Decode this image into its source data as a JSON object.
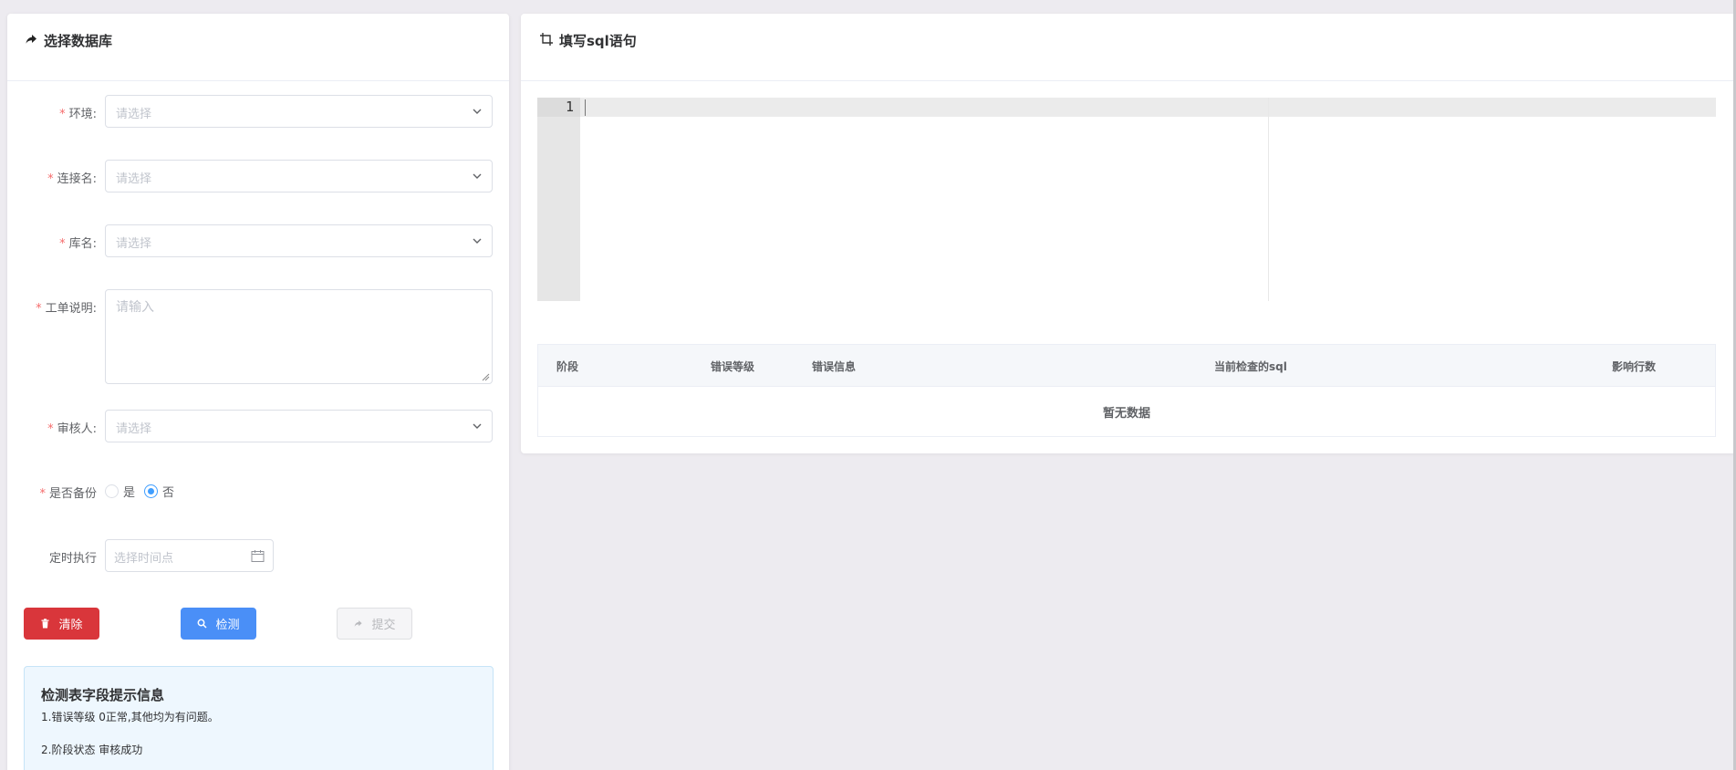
{
  "left": {
    "title": "选择数据库",
    "fields": {
      "env": {
        "label": "环境:",
        "placeholder": "请选择"
      },
      "conn": {
        "label": "连接名:",
        "placeholder": "请选择"
      },
      "db": {
        "label": "库名:",
        "placeholder": "请选择"
      },
      "desc": {
        "label": "工单说明:",
        "placeholder": "请输入"
      },
      "reviewer": {
        "label": "审核人:",
        "placeholder": "请选择"
      },
      "backup": {
        "label": "是否备份",
        "options": [
          "是",
          "否"
        ],
        "selected": "否"
      },
      "schedule": {
        "label": "定时执行",
        "placeholder": "选择时间点"
      }
    },
    "required_mark": "*",
    "buttons": {
      "clear": "清除",
      "check": "检测",
      "submit": "提交"
    },
    "tips": {
      "title": "检测表字段提示信息",
      "line1": "1.错误等级 0正常,其他均为有问题。",
      "line2": "2.阶段状态 审核成功"
    }
  },
  "right": {
    "title": "填写sql语句",
    "editor": {
      "line_number": "1",
      "content": ""
    },
    "table": {
      "columns": [
        "阶段",
        "错误等级",
        "错误信息",
        "当前检查的sql",
        "影响行数"
      ],
      "empty_text": "暂无数据"
    }
  },
  "colors": {
    "danger": "#d9363b",
    "primary": "#4a8ff7",
    "required": "#f56c6c",
    "tips_bg": "#eef7fe"
  }
}
